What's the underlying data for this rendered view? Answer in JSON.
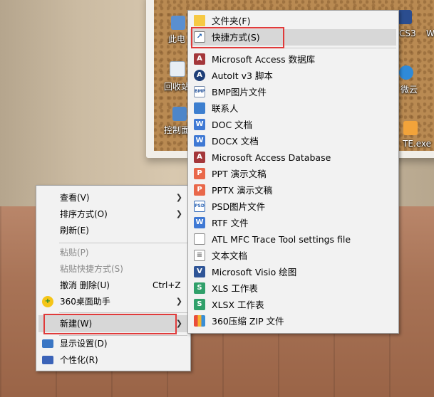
{
  "desktop": {
    "icons": [
      {
        "label": "此电",
        "glyph": "computer-icon"
      },
      {
        "label": "回收站",
        "glyph": "recycle-bin-icon"
      },
      {
        "label": "控制面",
        "glyph": "control-panel-icon"
      },
      {
        "label": "CS3",
        "glyph": "app-icon"
      },
      {
        "label": "W",
        "glyph": "app-icon"
      },
      {
        "label": "微云",
        "glyph": "cloud-icon"
      },
      {
        "label": "TE.exe",
        "glyph": "exe-icon"
      }
    ]
  },
  "context_menu": {
    "items": [
      {
        "label": "查看(V)",
        "has_submenu": true
      },
      {
        "label": "排序方式(O)",
        "has_submenu": true
      },
      {
        "label": "刷新(E)"
      },
      {
        "label": "粘贴(P)",
        "disabled": true
      },
      {
        "label": "粘贴快捷方式(S)",
        "disabled": true
      },
      {
        "label": "撤消 删除(U)",
        "shortcut": "Ctrl+Z"
      },
      {
        "label": "360桌面助手",
        "has_submenu": true,
        "icon": "360-assistant-icon"
      },
      {
        "label": "新建(W)",
        "has_submenu": true,
        "highlighted": true
      },
      {
        "label": "显示设置(D)",
        "icon": "display-settings-icon"
      },
      {
        "label": "个性化(R)",
        "icon": "personalize-icon"
      }
    ]
  },
  "new_submenu": {
    "items": [
      {
        "label": "文件夹(F)",
        "icon": "folder-icon"
      },
      {
        "label": "快捷方式(S)",
        "icon": "shortcut-icon",
        "highlighted": true
      },
      {
        "label": "Microsoft Access 数据库",
        "icon": "access-icon"
      },
      {
        "label": "AutoIt v3 脚本",
        "icon": "autoit-icon"
      },
      {
        "label": "BMP图片文件",
        "icon": "bmp-icon"
      },
      {
        "label": "联系人",
        "icon": "contact-icon"
      },
      {
        "label": "DOC 文档",
        "icon": "doc-icon"
      },
      {
        "label": "DOCX 文档",
        "icon": "docx-icon"
      },
      {
        "label": "Microsoft Access Database",
        "icon": "access-icon"
      },
      {
        "label": "PPT 演示文稿",
        "icon": "ppt-icon"
      },
      {
        "label": "PPTX 演示文稿",
        "icon": "pptx-icon"
      },
      {
        "label": "PSD图片文件",
        "icon": "psd-icon"
      },
      {
        "label": "RTF 文件",
        "icon": "rtf-icon"
      },
      {
        "label": "ATL MFC Trace Tool settings file",
        "icon": "atl-icon"
      },
      {
        "label": "文本文档",
        "icon": "text-icon"
      },
      {
        "label": "Microsoft Visio 绘图",
        "icon": "visio-icon"
      },
      {
        "label": "XLS 工作表",
        "icon": "xls-icon"
      },
      {
        "label": "XLSX 工作表",
        "icon": "xlsx-icon"
      },
      {
        "label": "360压缩 ZIP 文件",
        "icon": "zip-icon"
      }
    ]
  },
  "colors": {
    "menu_bg": "#f2f2f2",
    "highlight": "#d7d7d7",
    "annotation_box": "#e03a3a",
    "wps_blue": "#3f79d4",
    "wps_orange": "#e9684a",
    "wps_green": "#30a06a"
  }
}
